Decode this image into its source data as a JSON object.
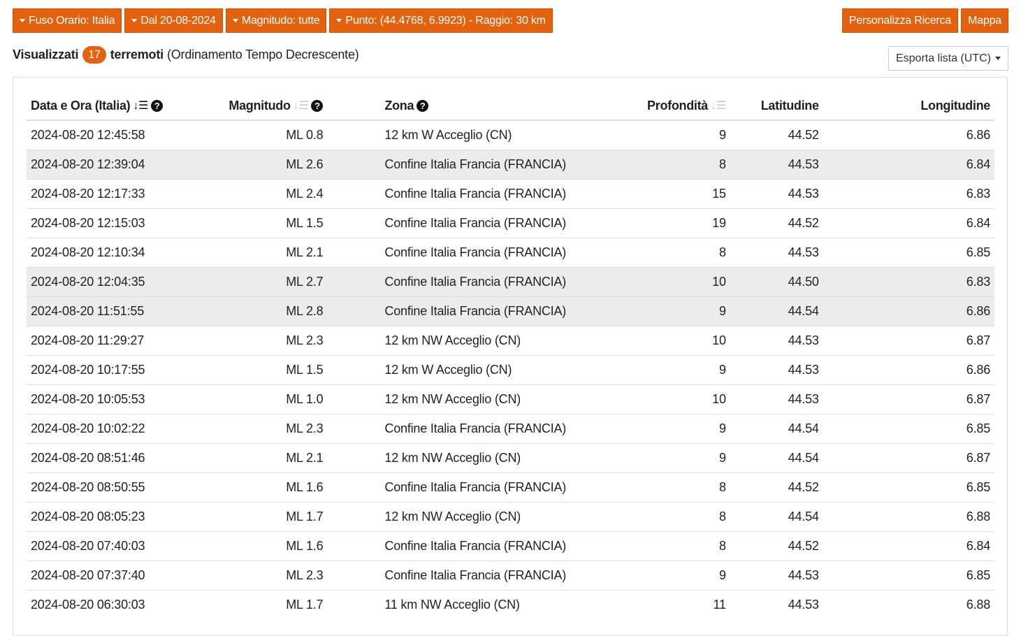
{
  "filters": [
    {
      "label": "Fuso Orario: Italia"
    },
    {
      "label": "Dal 20-08-2024"
    },
    {
      "label": "Magnitudo: tutte"
    },
    {
      "label": "Punto: (44.4768, 6.9923) - Raggio: 30 km"
    }
  ],
  "actions": {
    "customize": "Personalizza Ricerca",
    "map": "Mappa"
  },
  "summary": {
    "prefix": "Visualizzati",
    "count": "17",
    "noun": "terremoti",
    "sort_note": "(Ordinamento Tempo Decrescente)"
  },
  "export": {
    "label": "Esporta lista (UTC)"
  },
  "icons": {
    "sort_desc": "sort-desc-icon",
    "sort_inactive": "sort-icon",
    "info": "question-circle-icon"
  },
  "colors": {
    "accent": "#e2620f",
    "row_highlight": "#ececec"
  },
  "table": {
    "headers": {
      "datetime": "Data e Ora (Italia)",
      "magnitude": "Magnitudo",
      "zone": "Zona",
      "depth": "Profondità",
      "lat": "Latitudine",
      "lon": "Longitudine"
    },
    "rows": [
      {
        "datetime": "2024-08-20 12:45:58",
        "magnitude": "ML 0.8",
        "zone": "12 km W Acceglio (CN)",
        "depth": "9",
        "lat": "44.52",
        "lon": "6.86",
        "highlight": false
      },
      {
        "datetime": "2024-08-20 12:39:04",
        "magnitude": "ML 2.6",
        "zone": "Confine Italia Francia (FRANCIA)",
        "depth": "8",
        "lat": "44.53",
        "lon": "6.84",
        "highlight": true
      },
      {
        "datetime": "2024-08-20 12:17:33",
        "magnitude": "ML 2.4",
        "zone": "Confine Italia Francia (FRANCIA)",
        "depth": "15",
        "lat": "44.53",
        "lon": "6.83",
        "highlight": false
      },
      {
        "datetime": "2024-08-20 12:15:03",
        "magnitude": "ML 1.5",
        "zone": "Confine Italia Francia (FRANCIA)",
        "depth": "19",
        "lat": "44.52",
        "lon": "6.84",
        "highlight": false
      },
      {
        "datetime": "2024-08-20 12:10:34",
        "magnitude": "ML 2.1",
        "zone": "Confine Italia Francia (FRANCIA)",
        "depth": "8",
        "lat": "44.53",
        "lon": "6.85",
        "highlight": false
      },
      {
        "datetime": "2024-08-20 12:04:35",
        "magnitude": "ML 2.7",
        "zone": "Confine Italia Francia (FRANCIA)",
        "depth": "10",
        "lat": "44.50",
        "lon": "6.83",
        "highlight": true
      },
      {
        "datetime": "2024-08-20 11:51:55",
        "magnitude": "ML 2.8",
        "zone": "Confine Italia Francia (FRANCIA)",
        "depth": "9",
        "lat": "44.54",
        "lon": "6.86",
        "highlight": true
      },
      {
        "datetime": "2024-08-20 11:29:27",
        "magnitude": "ML 2.3",
        "zone": "12 km NW Acceglio (CN)",
        "depth": "10",
        "lat": "44.53",
        "lon": "6.87",
        "highlight": false
      },
      {
        "datetime": "2024-08-20 10:17:55",
        "magnitude": "ML 1.5",
        "zone": "12 km W Acceglio (CN)",
        "depth": "9",
        "lat": "44.53",
        "lon": "6.86",
        "highlight": false
      },
      {
        "datetime": "2024-08-20 10:05:53",
        "magnitude": "ML 1.0",
        "zone": "12 km NW Acceglio (CN)",
        "depth": "10",
        "lat": "44.53",
        "lon": "6.87",
        "highlight": false
      },
      {
        "datetime": "2024-08-20 10:02:22",
        "magnitude": "ML 2.3",
        "zone": "Confine Italia Francia (FRANCIA)",
        "depth": "9",
        "lat": "44.54",
        "lon": "6.85",
        "highlight": false
      },
      {
        "datetime": "2024-08-20 08:51:46",
        "magnitude": "ML 2.1",
        "zone": "12 km NW Acceglio (CN)",
        "depth": "9",
        "lat": "44.54",
        "lon": "6.87",
        "highlight": false
      },
      {
        "datetime": "2024-08-20 08:50:55",
        "magnitude": "ML 1.6",
        "zone": "Confine Italia Francia (FRANCIA)",
        "depth": "8",
        "lat": "44.52",
        "lon": "6.85",
        "highlight": false
      },
      {
        "datetime": "2024-08-20 08:05:23",
        "magnitude": "ML 1.7",
        "zone": "12 km NW Acceglio (CN)",
        "depth": "8",
        "lat": "44.54",
        "lon": "6.88",
        "highlight": false
      },
      {
        "datetime": "2024-08-20 07:40:03",
        "magnitude": "ML 1.6",
        "zone": "Confine Italia Francia (FRANCIA)",
        "depth": "8",
        "lat": "44.52",
        "lon": "6.84",
        "highlight": false
      },
      {
        "datetime": "2024-08-20 07:37:40",
        "magnitude": "ML 2.3",
        "zone": "Confine Italia Francia (FRANCIA)",
        "depth": "9",
        "lat": "44.53",
        "lon": "6.85",
        "highlight": false
      },
      {
        "datetime": "2024-08-20 06:30:03",
        "magnitude": "ML 1.7",
        "zone": "11 km NW Acceglio (CN)",
        "depth": "11",
        "lat": "44.53",
        "lon": "6.88",
        "highlight": false
      }
    ]
  }
}
